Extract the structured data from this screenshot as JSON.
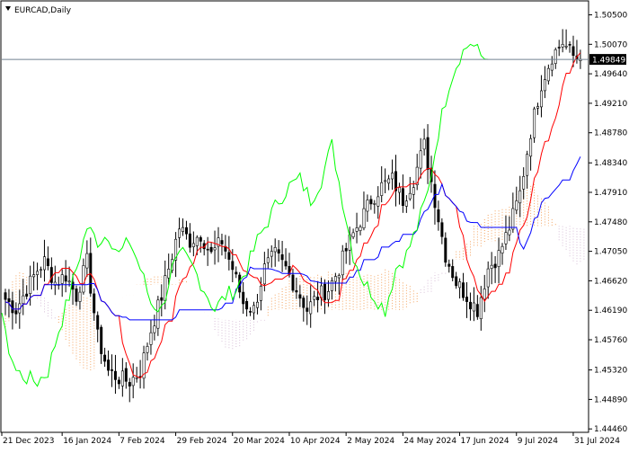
{
  "window": {
    "title": "EURCAD,Daily",
    "menu_icon": "triangle-down-icon"
  },
  "chart_data": {
    "type": "candlestick",
    "symbol": "EURCAD",
    "timeframe": "Daily",
    "current_price": 1.49849,
    "ylim": [
      1.4441,
      1.5069
    ],
    "y_ticks": [
      1.505,
      1.5007,
      1.4964,
      1.4921,
      1.4878,
      1.4834,
      1.4791,
      1.4748,
      1.4705,
      1.4662,
      1.4619,
      1.4576,
      1.4532,
      1.4489,
      1.4446
    ],
    "y_tick_labels": [
      "1.50500",
      "1.50070",
      "1.49640",
      "1.49210",
      "1.48780",
      "1.48340",
      "1.47910",
      "1.47480",
      "1.47050",
      "1.46620",
      "1.46190",
      "1.45760",
      "1.45320",
      "1.44890",
      "1.44460"
    ],
    "x_tick_labels": [
      "21 Dec 2023",
      "16 Jan 2024",
      "7 Feb 2024",
      "29 Feb 2024",
      "20 Mar 2024",
      "10 Apr 2024",
      "2 May 2024",
      "24 May 2024",
      "17 Jun 2024",
      "9 Jul 2024",
      "31 Jul 2024"
    ],
    "x_tick_bars": [
      0,
      17,
      33,
      49,
      65,
      81,
      97,
      113,
      129,
      145,
      161
    ],
    "grid": false,
    "colors": {
      "candles": "#000000",
      "tenkan": "#ff0000",
      "kijun": "#0000ff",
      "chikou": "#00ff00",
      "cloud_bull": "#f4a460",
      "cloud_bear": "#d8bfd8",
      "price_line": "#708090",
      "price_label_bg": "#000000",
      "price_label_text": "#ffffff"
    },
    "close_anchors": [
      [
        0,
        1.4635
      ],
      [
        3,
        1.462
      ],
      [
        6,
        1.465
      ],
      [
        9,
        1.4678
      ],
      [
        11,
        1.469
      ],
      [
        14,
        1.466
      ],
      [
        17,
        1.467
      ],
      [
        20,
        1.464
      ],
      [
        23,
        1.469
      ],
      [
        26,
        1.458
      ],
      [
        29,
        1.453
      ],
      [
        32,
        1.452
      ],
      [
        35,
        1.4515
      ],
      [
        38,
        1.453
      ],
      [
        41,
        1.459
      ],
      [
        44,
        1.464
      ],
      [
        47,
        1.47
      ],
      [
        49,
        1.474
      ],
      [
        52,
        1.472
      ],
      [
        55,
        1.473
      ],
      [
        58,
        1.47
      ],
      [
        61,
        1.472
      ],
      [
        64,
        1.468
      ],
      [
        67,
        1.463
      ],
      [
        70,
        1.462
      ],
      [
        73,
        1.468
      ],
      [
        76,
        1.47
      ],
      [
        79,
        1.468
      ],
      [
        82,
        1.465
      ],
      [
        85,
        1.462
      ],
      [
        88,
        1.464
      ],
      [
        91,
        1.465
      ],
      [
        94,
        1.468
      ],
      [
        97,
        1.472
      ],
      [
        100,
        1.475
      ],
      [
        103,
        1.478
      ],
      [
        106,
        1.48
      ],
      [
        109,
        1.481
      ],
      [
        112,
        1.478
      ],
      [
        115,
        1.481
      ],
      [
        118,
        1.486
      ],
      [
        121,
        1.478
      ],
      [
        124,
        1.47
      ],
      [
        127,
        1.466
      ],
      [
        130,
        1.464
      ],
      [
        133,
        1.462
      ],
      [
        136,
        1.468
      ],
      [
        139,
        1.47
      ],
      [
        142,
        1.474
      ],
      [
        145,
        1.479
      ],
      [
        148,
        1.488
      ],
      [
        151,
        1.495
      ],
      [
        154,
        1.499
      ],
      [
        157,
        1.501
      ],
      [
        160,
        1.499
      ],
      [
        162,
        1.49849
      ]
    ]
  }
}
